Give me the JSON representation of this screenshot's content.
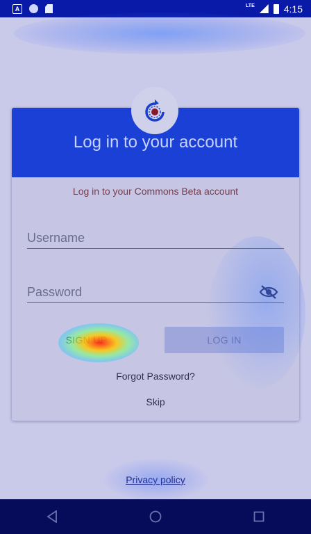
{
  "status_bar": {
    "lte": "LTE",
    "time": "4:15"
  },
  "card": {
    "title": "Log in to your account",
    "subtitle": "Log in to your Commons Beta account",
    "username_placeholder": "Username",
    "password_placeholder": "Password",
    "signup_label": "SIGN UP",
    "login_label": "LOG IN",
    "forgot_label": "Forgot Password?",
    "skip_label": "Skip"
  },
  "footer": {
    "privacy_label": "Privacy policy"
  },
  "nav": {
    "back": "back-icon",
    "home": "home-icon",
    "recents": "recents-icon"
  },
  "colors": {
    "header": "#1a40d6",
    "status_bar": "#0a1aa8",
    "nav_bar": "#070c5a"
  }
}
